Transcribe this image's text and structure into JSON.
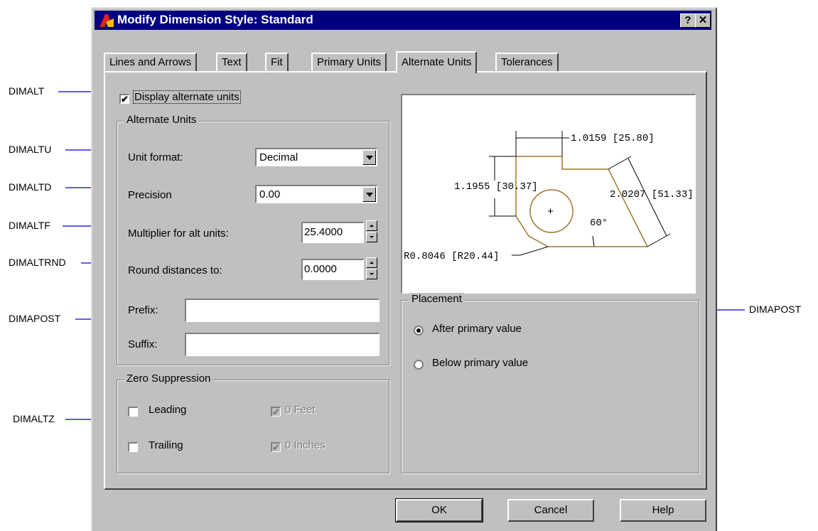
{
  "window": {
    "title": "Modify Dimension Style: Standard",
    "help_button": "?",
    "close_button": "✕"
  },
  "tabs": [
    {
      "label": "Lines and Arrows",
      "active": false
    },
    {
      "label": "Text",
      "active": false
    },
    {
      "label": "Fit",
      "active": false
    },
    {
      "label": "Primary Units",
      "active": false
    },
    {
      "label": "Alternate Units",
      "active": true
    },
    {
      "label": "Tolerances",
      "active": false
    }
  ],
  "display_alternate_units": {
    "label": "Display alternate units",
    "checked": true,
    "check_glyph": "✔"
  },
  "alternate_units": {
    "group_title": "Alternate Units",
    "unit_format": {
      "label": "Unit format:",
      "value": "Decimal"
    },
    "precision": {
      "label": "Precision",
      "value": "0.00"
    },
    "multiplier": {
      "label": "Multiplier for alt units:",
      "value": "25.4000"
    },
    "round": {
      "label": "Round distances  to:",
      "value": "0.0000"
    },
    "prefix": {
      "label": "Prefix:",
      "value": ""
    },
    "suffix": {
      "label": "Suffix:",
      "value": ""
    }
  },
  "zero_suppression": {
    "group_title": "Zero Suppression",
    "leading": {
      "label": "Leading",
      "checked": false
    },
    "trailing": {
      "label": "Trailing",
      "checked": false
    },
    "feet": {
      "label": "0 Feet",
      "checked": true,
      "enabled": false
    },
    "inches": {
      "label": "0 Inches",
      "checked": true,
      "enabled": false
    }
  },
  "preview": {
    "dim_top": "1.0159 [25.80]",
    "dim_left": "1.1955 [30.37]",
    "dim_right": "2.0207 [51.33]",
    "angle": "60°",
    "radius": "R0.8046 [R20.44]",
    "center_mark": "+",
    "colors": {
      "part": "#a0782a",
      "dim": "#000000"
    }
  },
  "placement": {
    "group_title": "Placement",
    "after": {
      "label": "After primary value",
      "selected": true
    },
    "below": {
      "label": "Below primary value",
      "selected": false
    }
  },
  "buttons": {
    "ok": "OK",
    "cancel": "Cancel",
    "help": "Help"
  },
  "callouts": {
    "dimalt": "DIMALT",
    "dimaltu": "DIMALTU",
    "dimaltd": "DIMALTD",
    "dimaltf": "DIMALTF",
    "dimaltrnd": "DIMALTRND",
    "dimapost_left": "DIMAPOST",
    "dimaltz": "DIMALTZ",
    "dimapost_right": "DIMAPOST",
    "line_color": "#0000cc"
  },
  "accent": {
    "titlebar": "#000080",
    "face": "#c0c0c0"
  }
}
